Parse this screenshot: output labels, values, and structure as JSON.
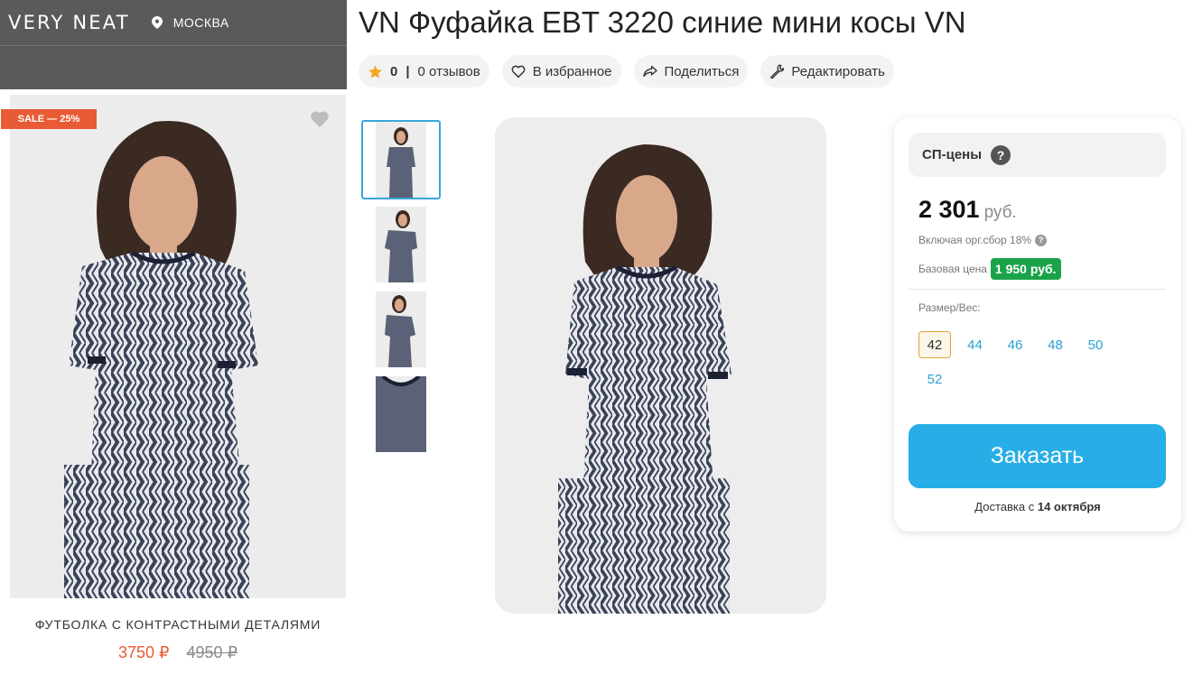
{
  "ad": {
    "brand": "VERY NEAT",
    "location": "МОСКВА",
    "sale_badge": "SALE — 25%",
    "product_title": "ФУТБОЛКА С КОНТРАСТНЫМИ ДЕТАЛЯМИ",
    "price_new": "3750 ₽",
    "price_old": "4950 ₽"
  },
  "product": {
    "title": "VN Фуфайка EBT 3220 синие мини косы VN"
  },
  "actions": {
    "rating": "0",
    "reviews": "0 отзывов",
    "favorite": "В избранное",
    "share": "Поделиться",
    "edit": "Редактировать"
  },
  "gallery": {
    "thumbnails": [
      "front",
      "side",
      "side-2",
      "detail"
    ],
    "active_index": 0
  },
  "pricing": {
    "sp_label": "СП-цены",
    "help_glyph": "?",
    "price": "2 301",
    "currency": "руб.",
    "includes": "Включая орг.сбор 18%",
    "base_label": "Базовая цена",
    "base_price": "1 950 руб.",
    "size_label": "Размер/Вес:",
    "sizes": [
      "42",
      "44",
      "46",
      "48",
      "50",
      "52"
    ],
    "selected_size": "42",
    "order_button": "Заказать",
    "delivery_prefix": "Доставка с",
    "delivery_date": "14 октября"
  },
  "colors": {
    "accent_blue": "#27aee6",
    "sale_orange": "#e85b34",
    "base_green": "#1aa34a",
    "star": "#f5a623"
  }
}
